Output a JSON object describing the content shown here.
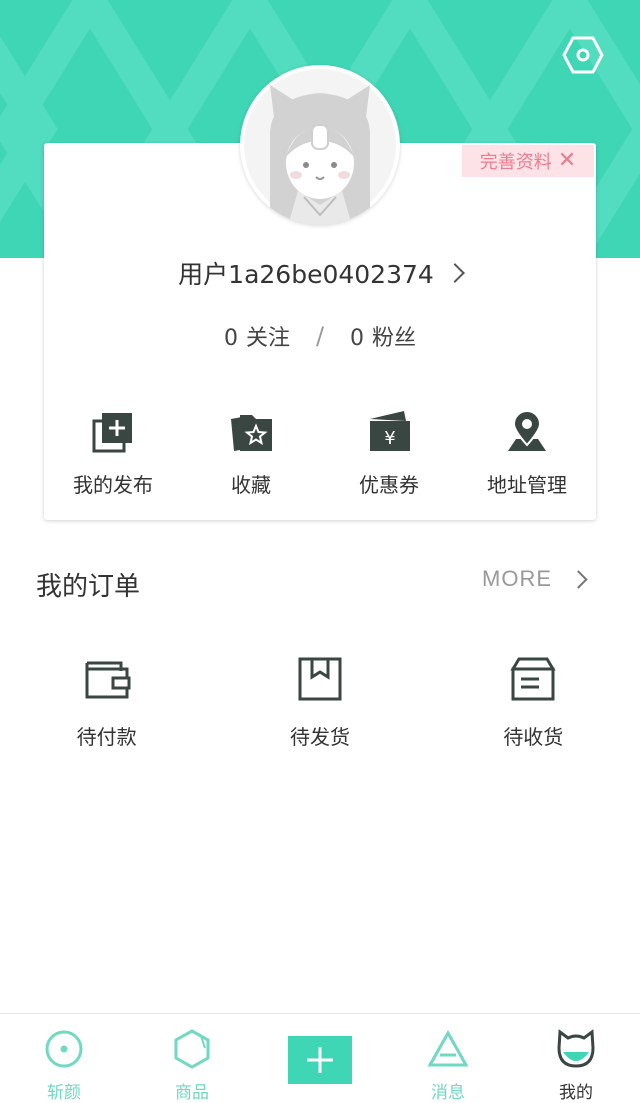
{
  "profile": {
    "complete_label": "完善资料",
    "complete_close": "✕",
    "username": "用户1a26be0402374",
    "following_count": "0",
    "following_label": "关注",
    "separator": "/",
    "fans_count": "0",
    "fans_label": "粉丝"
  },
  "quick_actions": [
    {
      "label": "我的发布",
      "icon": "publish-icon"
    },
    {
      "label": "收藏",
      "icon": "favorites-folder-icon"
    },
    {
      "label": "优惠券",
      "icon": "coupon-icon"
    },
    {
      "label": "地址管理",
      "icon": "location-pin-icon"
    }
  ],
  "orders": {
    "title": "我的订单",
    "more_label": "MORE",
    "items": [
      {
        "label": "待付款",
        "icon": "wallet-icon"
      },
      {
        "label": "待发货",
        "icon": "package-icon"
      },
      {
        "label": "待收货",
        "icon": "delivery-box-icon"
      }
    ]
  },
  "tabbar": {
    "tabs": [
      {
        "label": "斩颜",
        "icon": "circle-dot-icon"
      },
      {
        "label": "商品",
        "icon": "hexagon-icon"
      },
      {
        "label": "",
        "icon": "plus-icon"
      },
      {
        "label": "消息",
        "icon": "triangle-icon"
      },
      {
        "label": "我的",
        "icon": "cat-face-icon"
      }
    ],
    "active": "我的"
  },
  "colors": {
    "accent": "#3fd6b6",
    "tab_inactive": "#6fd9c2",
    "tag_bg": "#fde3e8",
    "tag_text": "#ee7b8f",
    "icon_dark": "#3a4642"
  }
}
